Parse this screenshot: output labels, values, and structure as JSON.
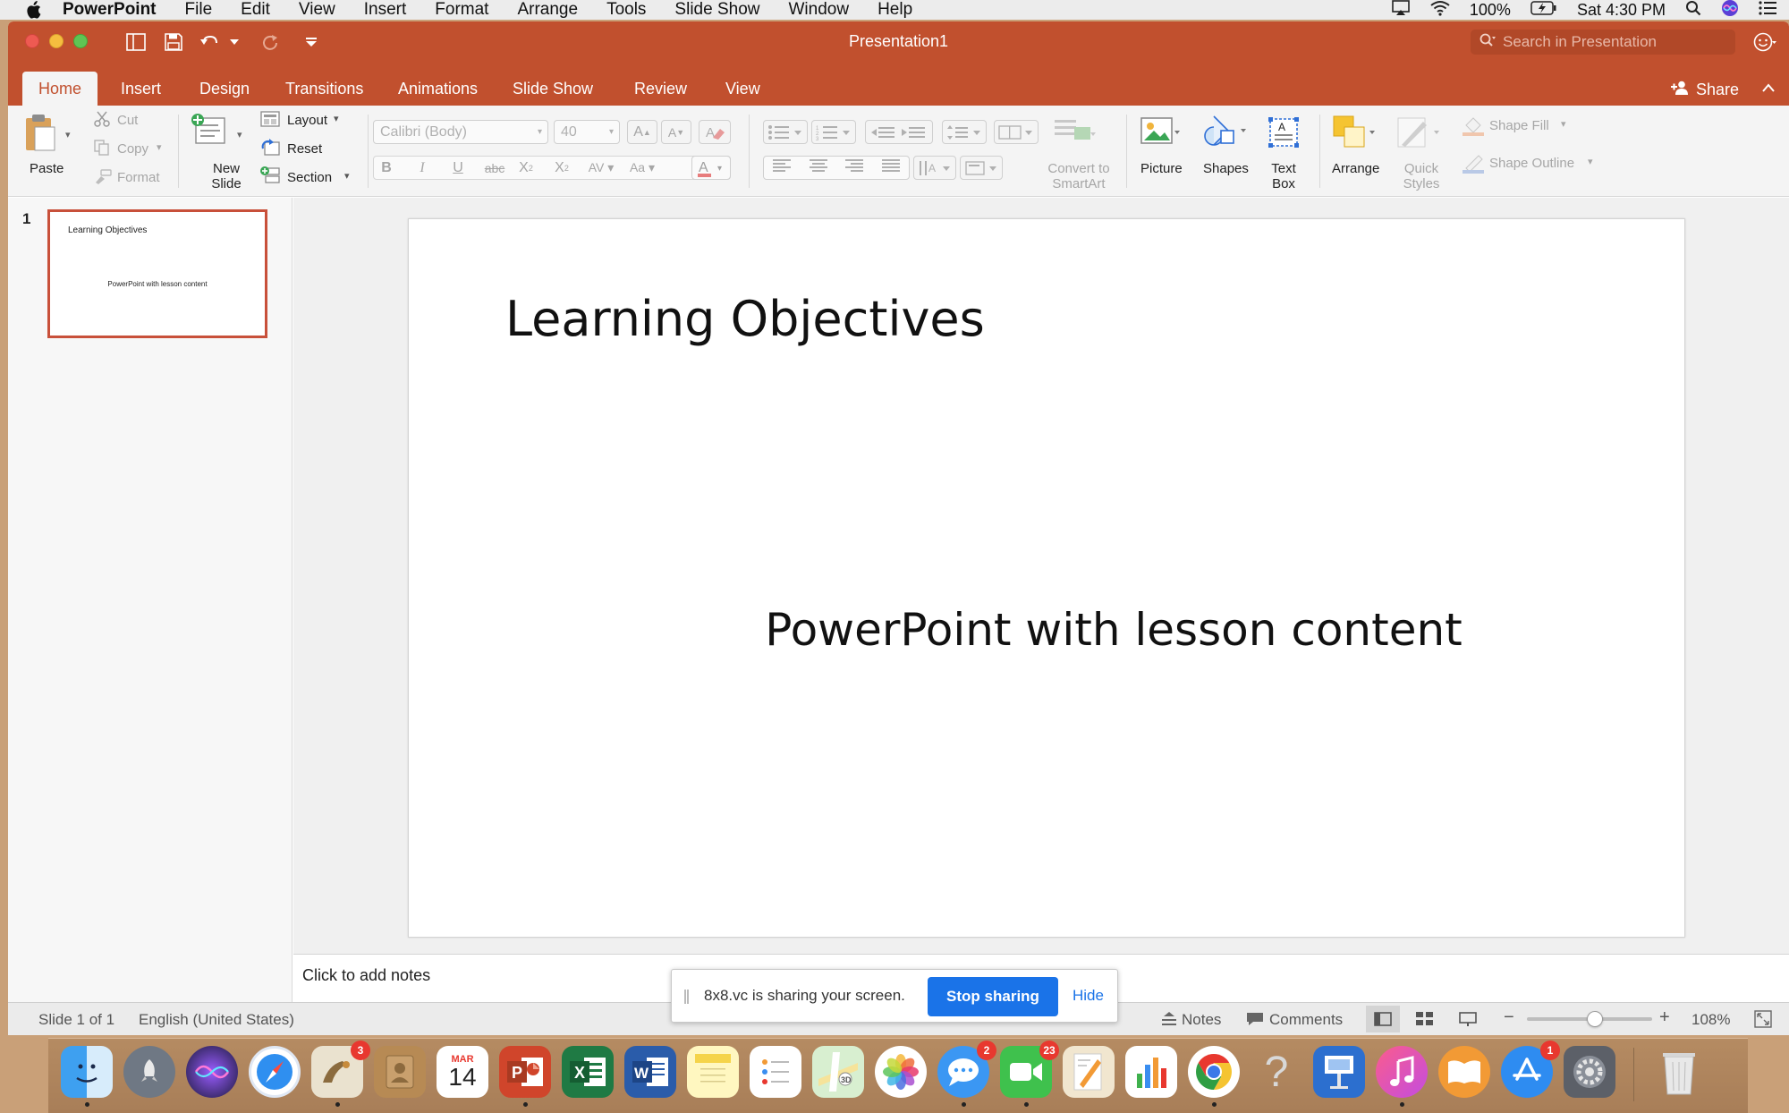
{
  "menubar": {
    "app": "PowerPoint",
    "items": [
      "File",
      "Edit",
      "View",
      "Insert",
      "Format",
      "Arrange",
      "Tools",
      "Slide Show",
      "Window",
      "Help"
    ],
    "battery": "100%",
    "clock": "Sat 4:30 PM"
  },
  "window": {
    "title": "Presentation1",
    "search_placeholder": "Search in Presentation",
    "share_label": "Share"
  },
  "tabs": [
    "Home",
    "Insert",
    "Design",
    "Transitions",
    "Animations",
    "Slide Show",
    "Review",
    "View"
  ],
  "ribbon": {
    "paste": "Paste",
    "cut": "Cut",
    "copy": "Copy",
    "format": "Format",
    "new_slide_1": "New",
    "new_slide_2": "Slide",
    "layout": "Layout",
    "reset": "Reset",
    "section": "Section",
    "font_name": "Calibri (Body)",
    "font_size": "40",
    "convert_1": "Convert to",
    "convert_2": "SmartArt",
    "picture": "Picture",
    "shapes": "Shapes",
    "textbox_1": "Text",
    "textbox_2": "Box",
    "arrange": "Arrange",
    "quick_1": "Quick",
    "quick_2": "Styles",
    "shape_fill": "Shape Fill",
    "shape_outline": "Shape Outline"
  },
  "thumbnails": [
    {
      "number": "1",
      "title": "Learning Objectives",
      "body": "PowerPoint with lesson content"
    }
  ],
  "slide": {
    "title": "Learning Objectives",
    "body": "PowerPoint with lesson content"
  },
  "notes": {
    "placeholder": "Click to add notes"
  },
  "status": {
    "slide_info": "Slide 1 of 1",
    "language": "English (United States)",
    "notes": "Notes",
    "comments": "Comments",
    "zoom": "108%",
    "zoom_level": 0.55
  },
  "sharebar": {
    "message": "8x8.vc is sharing your screen.",
    "stop": "Stop sharing",
    "hide": "Hide"
  },
  "dock": {
    "mail_badge": "3",
    "calendar_month": "MAR",
    "calendar_day": "14",
    "messages_badge": "2",
    "facetime_badge": "23",
    "appstore_badge": "1"
  },
  "colors": {
    "accent": "#c1502e",
    "link": "#1a73e8",
    "badge": "#e8382f"
  }
}
